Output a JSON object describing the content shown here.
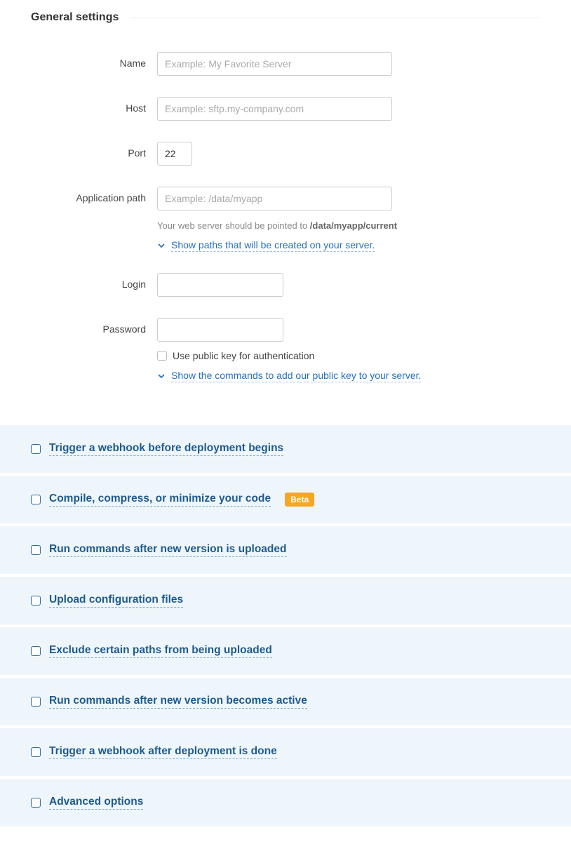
{
  "section_title": "General settings",
  "fields": {
    "name": {
      "label": "Name",
      "placeholder": "Example: My Favorite Server",
      "value": ""
    },
    "host": {
      "label": "Host",
      "placeholder": "Example: sftp.my-company.com",
      "value": ""
    },
    "port": {
      "label": "Port",
      "value": "22"
    },
    "app_path": {
      "label": "Application path",
      "placeholder": "Example: /data/myapp",
      "value": "",
      "helper_prefix": "Your web server should be pointed to ",
      "helper_path": "/data/myapp/current",
      "expand_link": "Show paths that will be created on your server."
    },
    "login": {
      "label": "Login",
      "value": ""
    },
    "password": {
      "label": "Password",
      "value": "",
      "pubkey_checkbox_label": "Use public key for authentication",
      "expand_link": "Show the commands to add our public key to your server."
    }
  },
  "options": [
    {
      "label": "Trigger a webhook before deployment begins",
      "beta": false
    },
    {
      "label": "Compile, compress, or minimize your code",
      "beta": true
    },
    {
      "label": "Run commands after new version is uploaded",
      "beta": false
    },
    {
      "label": "Upload configuration files",
      "beta": false
    },
    {
      "label": "Exclude certain paths from being uploaded",
      "beta": false
    },
    {
      "label": "Run commands after new version becomes active",
      "beta": false
    },
    {
      "label": "Trigger a webhook after deployment is done",
      "beta": false
    },
    {
      "label": "Advanced options",
      "beta": false
    }
  ],
  "badge_text": "Beta"
}
